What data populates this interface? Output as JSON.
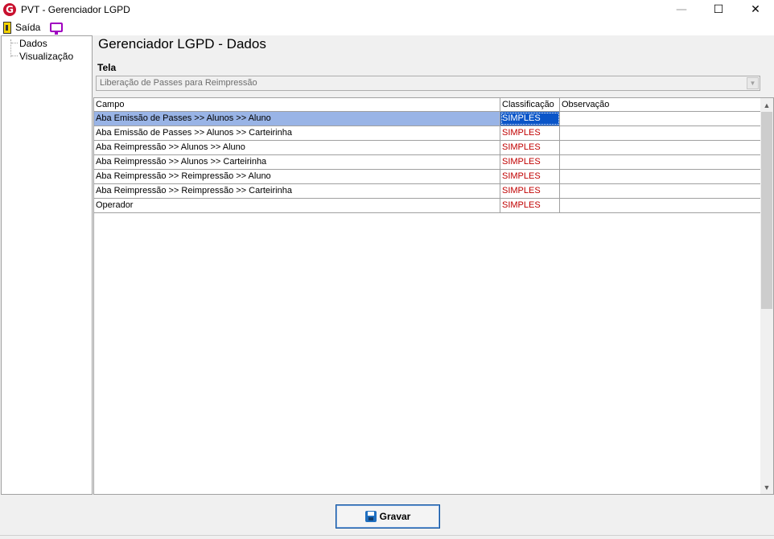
{
  "window": {
    "title": "PVT - Gerenciador LGPD",
    "minimize": "—",
    "maximize": "☐",
    "close": "✕"
  },
  "menu": {
    "exit_label": "Saída",
    "exit_icon": "exit-door-icon",
    "screen_icon": "monitor-icon"
  },
  "tree": {
    "items": [
      {
        "label": "Dados"
      },
      {
        "label": "Visualização"
      }
    ]
  },
  "main": {
    "title": "Gerenciador LGPD - Dados",
    "tela_label": "Tela",
    "tela_value": "Liberação de Passes para Reimpressão"
  },
  "grid": {
    "headers": {
      "campo": "Campo",
      "classificacao": "Classificação",
      "observacao": "Observação"
    },
    "rows": [
      {
        "campo": "Aba Emissão de Passes >> Alunos >> Aluno",
        "classificacao": "SIMPLES",
        "observacao": ""
      },
      {
        "campo": "Aba Emissão de Passes >> Alunos >> Carteirinha",
        "classificacao": "SIMPLES",
        "observacao": ""
      },
      {
        "campo": "Aba Reimpressão >> Alunos >> Aluno",
        "classificacao": "SIMPLES",
        "observacao": ""
      },
      {
        "campo": "Aba Reimpressão >> Alunos >> Carteirinha",
        "classificacao": "SIMPLES",
        "observacao": ""
      },
      {
        "campo": "Aba Reimpressão >> Reimpressão >> Aluno",
        "classificacao": "SIMPLES",
        "observacao": ""
      },
      {
        "campo": "Aba Reimpressão >> Reimpressão >> Carteirinha",
        "classificacao": "SIMPLES",
        "observacao": ""
      },
      {
        "campo": "Operador",
        "classificacao": "SIMPLES",
        "observacao": ""
      }
    ]
  },
  "footer": {
    "save_label": "Gravar"
  },
  "colors": {
    "selected_row": "#99b4e6",
    "selected_cell": "#0a55c8",
    "classification_text": "#c00000",
    "button_border": "#0a4f9c"
  }
}
